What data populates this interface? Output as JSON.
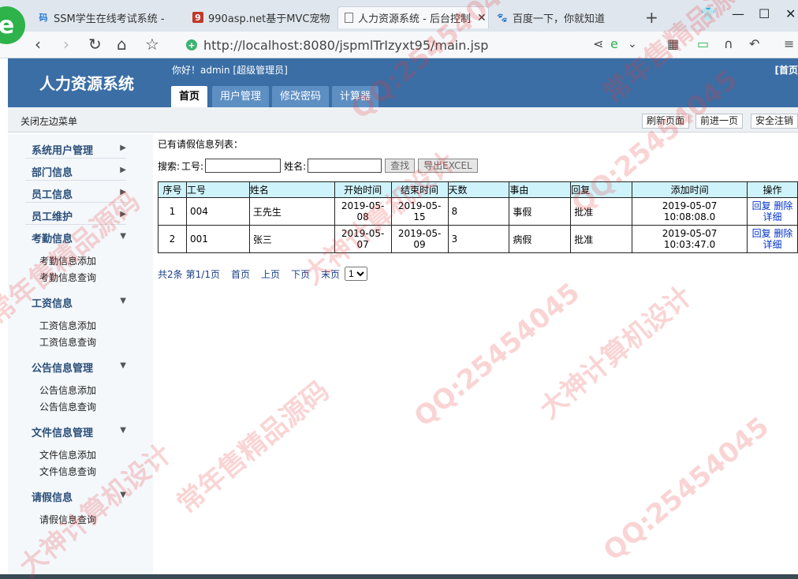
{
  "browser": {
    "tabs": [
      {
        "favicon": "csdn-icon",
        "label": "SSM学生在线考试系统 -"
      },
      {
        "favicon": "asp-icon",
        "label": "990asp.net基于MVC宠物"
      },
      {
        "favicon": "page-icon",
        "label": "人力资源系统 - 后台控制"
      },
      {
        "favicon": "baidu-icon",
        "label": "百度一下，你就知道"
      }
    ],
    "url": "http://localhost:8080/jspmlTrIzyxt95/main.jsp"
  },
  "header": {
    "title": "人力资源系统",
    "greeting": "你好！admin [超级管理员]",
    "home_link": "[首页",
    "nav": [
      "首页",
      "用户管理",
      "修改密码",
      "计算器"
    ]
  },
  "subbar": {
    "close_menu": "关闭左边菜单",
    "buttons": [
      "刷新页面",
      "前进一页",
      "安全注销"
    ]
  },
  "sidebar": {
    "groups": [
      {
        "label": "系统用户管理",
        "items": []
      },
      {
        "label": "部门信息",
        "items": []
      },
      {
        "label": "员工信息",
        "items": []
      },
      {
        "label": "员工维护",
        "items": []
      },
      {
        "label": "考勤信息",
        "items": [
          "考勤信息添加",
          "考勤信息查询"
        ]
      },
      {
        "label": "工资信息",
        "items": [
          "工资信息添加",
          "工资信息查询"
        ]
      },
      {
        "label": "公告信息管理",
        "items": [
          "公告信息添加",
          "公告信息查询"
        ]
      },
      {
        "label": "文件信息管理",
        "items": [
          "文件信息添加",
          "文件信息查询"
        ]
      },
      {
        "label": "请假信息",
        "items": [
          "请假信息查询"
        ]
      }
    ]
  },
  "content": {
    "list_title": "已有请假信息列表：",
    "search": {
      "label": "搜索:",
      "field1_label": "工号:",
      "field1_value": "",
      "field2_label": "姓名:",
      "field2_value": "",
      "search_button": "查找",
      "export_button": "导出EXCEL"
    },
    "table": {
      "headers": [
        "序号",
        "工号",
        "姓名",
        "开始时间",
        "结束时间",
        "天数",
        "事由",
        "回复",
        "添加时间",
        "操作"
      ],
      "rows": [
        {
          "no": "1",
          "emp_no": "004",
          "name": "王先生",
          "start": "2019-05-08",
          "end": "2019-05-15",
          "days": "8",
          "reason": "事假",
          "reply": "批准",
          "added": "2019-05-07 10:08:08.0",
          "ops": [
            "回复",
            "删除",
            "详细"
          ]
        },
        {
          "no": "2",
          "emp_no": "001",
          "name": "张三",
          "start": "2019-05-07",
          "end": "2019-05-09",
          "days": "3",
          "reason": "病假",
          "reply": "批准",
          "added": "2019-05-07 10:03:47.0",
          "ops": [
            "回复",
            "删除",
            "详细"
          ]
        }
      ]
    },
    "pager": {
      "total": "共2条",
      "page": "第1/1页",
      "first": "首页",
      "prev": "上页",
      "next": "下页",
      "last": "末页",
      "select_value": "1"
    }
  },
  "watermark": {
    "texts": [
      "QQ:25454045",
      "常年售精品源码",
      "大神计算机设计",
      "QQ:25454045",
      "常年售精品源码",
      "大神计算机设计",
      "QQ:25454045",
      "常年售精品源码",
      "大神计算机设计",
      "QQ:25454045"
    ]
  },
  "colors": {
    "header": "#3a6ea5",
    "table_header": "#cff3fb",
    "sidebar": "#f4f8fb",
    "link": "#0033cc"
  }
}
